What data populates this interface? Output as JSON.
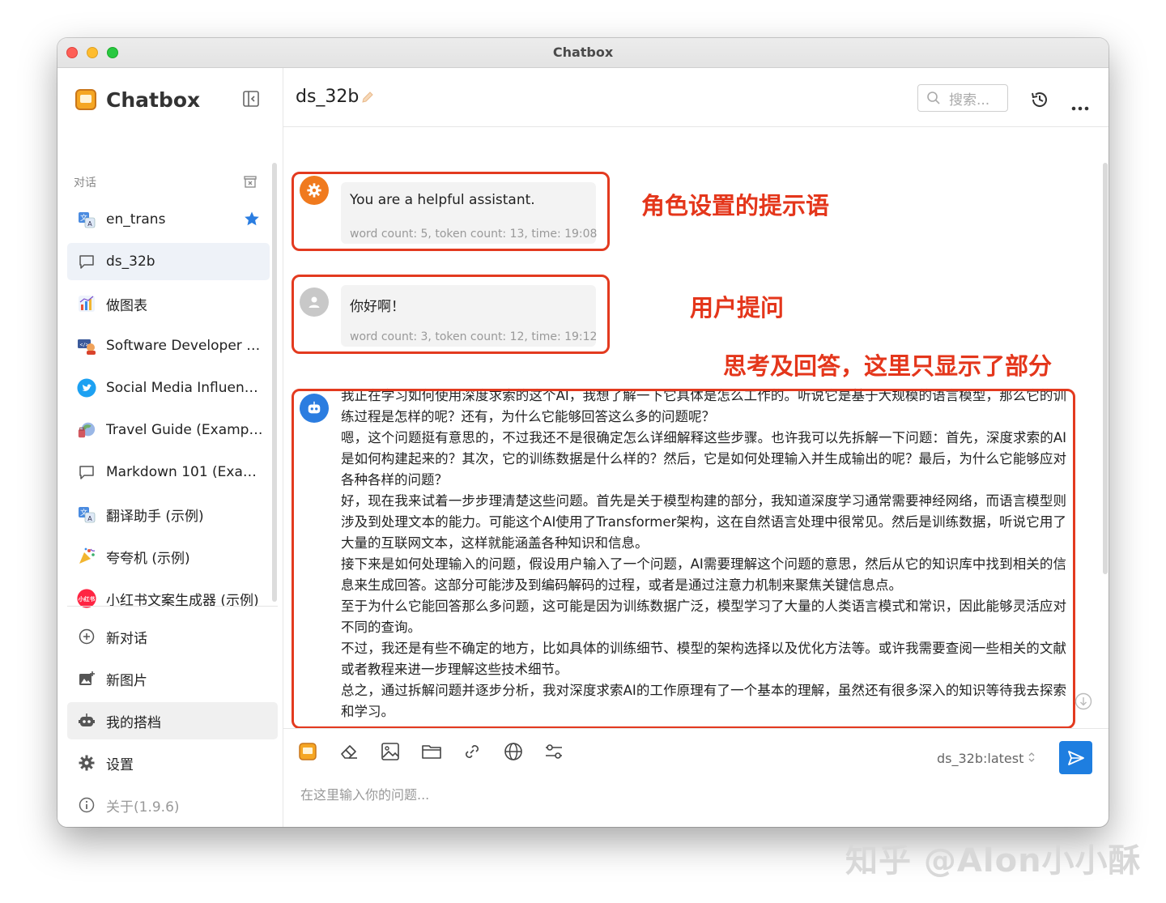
{
  "window": {
    "title": "Chatbox"
  },
  "sidebar": {
    "brand": "Chatbox",
    "section_label": "对话",
    "conversations": [
      {
        "label": "en_trans",
        "icon": "translate-icon",
        "starred": true
      },
      {
        "label": "ds_32b",
        "icon": "chat-bubble-icon",
        "active": true
      },
      {
        "label": "做图表",
        "icon": "chart-icon"
      },
      {
        "label": "Software Developer (E...",
        "icon": "developer-avatar-icon"
      },
      {
        "label": "Social Media Influence...",
        "icon": "twitter-bird-icon"
      },
      {
        "label": "Travel Guide (Example)",
        "icon": "globe-travel-icon"
      },
      {
        "label": "Markdown 101 (Examp...",
        "icon": "chat-bubble-icon"
      },
      {
        "label": "翻译助手 (示例)",
        "icon": "translate-icon"
      },
      {
        "label": "夸夸机 (示例)",
        "icon": "party-icon"
      },
      {
        "label": "小红书文案生成器 (示例)",
        "icon": "xiaohongshu-logo-icon",
        "icon_text": "小红书"
      }
    ],
    "actions": [
      {
        "label": "新对话",
        "icon": "plus-circle-icon"
      },
      {
        "label": "新图片",
        "icon": "image-add-icon"
      },
      {
        "label": "我的搭档",
        "icon": "robot-icon",
        "active": true
      },
      {
        "label": "设置",
        "icon": "gear-icon"
      },
      {
        "label": "关于(1.9.6)",
        "icon": "info-icon",
        "muted": true
      }
    ]
  },
  "header": {
    "title": "ds_32b",
    "search_placeholder": "搜索..."
  },
  "messages": {
    "system": {
      "text": "You are a helpful assistant.",
      "meta": "word count: 5, token count: 13, time: 19:08"
    },
    "user": {
      "text": "你好啊！",
      "meta": "word count: 3, token count: 12, time: 19:12"
    },
    "assistant_paragraphs": [
      "我正在学习如何使用深度求索的这个AI，我想了解一下它具体是怎么工作的。听说它是基于大规模的语言模型，那么它的训练过程是怎样的呢？还有，为什么它能够回答这么多的问题呢？",
      "嗯，这个问题挺有意思的，不过我还不是很确定怎么详细解释这些步骤。也许我可以先拆解一下问题：首先，深度求索的AI是如何构建起来的？其次，它的训练数据是什么样的？然后，它是如何处理输入并生成输出的呢？最后，为什么它能够应对各种各样的问题？",
      "好，现在我来试着一步步理清楚这些问题。首先是关于模型构建的部分，我知道深度学习通常需要神经网络，而语言模型则涉及到处理文本的能力。可能这个AI使用了Transformer架构，这在自然语言处理中很常见。然后是训练数据，听说它用了大量的互联网文本，这样就能涵盖各种知识和信息。",
      "接下来是如何处理输入的问题，假设用户输入了一个问题，AI需要理解这个问题的意思，然后从它的知识库中找到相关的信息来生成回答。这部分可能涉及到编码解码的过程，或者是通过注意力机制来聚焦关键信息点。",
      "至于为什么它能回答那么多问题，这可能是因为训练数据广泛，模型学习了大量的人类语言模式和常识，因此能够灵活应对不同的查询。",
      "不过，我还是有些不确定的地方，比如具体的训练细节、模型的架构选择以及优化方法等。或许我需要查阅一些相关的文献或者教程来进一步理解这些技术细节。",
      "总之，通过拆解问题并逐步分析，我对深度求索AI的工作原理有了一个基本的理解，虽然还有很多深入的知识等待我去探索和学习。"
    ]
  },
  "annotations": {
    "system": "角色设置的提示语",
    "user": "用户提问",
    "answer": "思考及回答，这里只显示了部分"
  },
  "composer": {
    "model": "ds_32b:latest",
    "placeholder": "在这里输入你的问题...",
    "tools": [
      "chatbox-logo-icon",
      "eraser-icon",
      "image-icon",
      "folder-icon",
      "link-icon",
      "globe-icon",
      "settings-sliders-icon"
    ]
  },
  "watermark": "知乎 @Alon小小酥",
  "colors": {
    "annotation_red": "#e33a1f",
    "accent_blue": "#1e7ee0",
    "system_avatar": "#f07a1e",
    "assistant_avatar": "#2b7de0"
  }
}
